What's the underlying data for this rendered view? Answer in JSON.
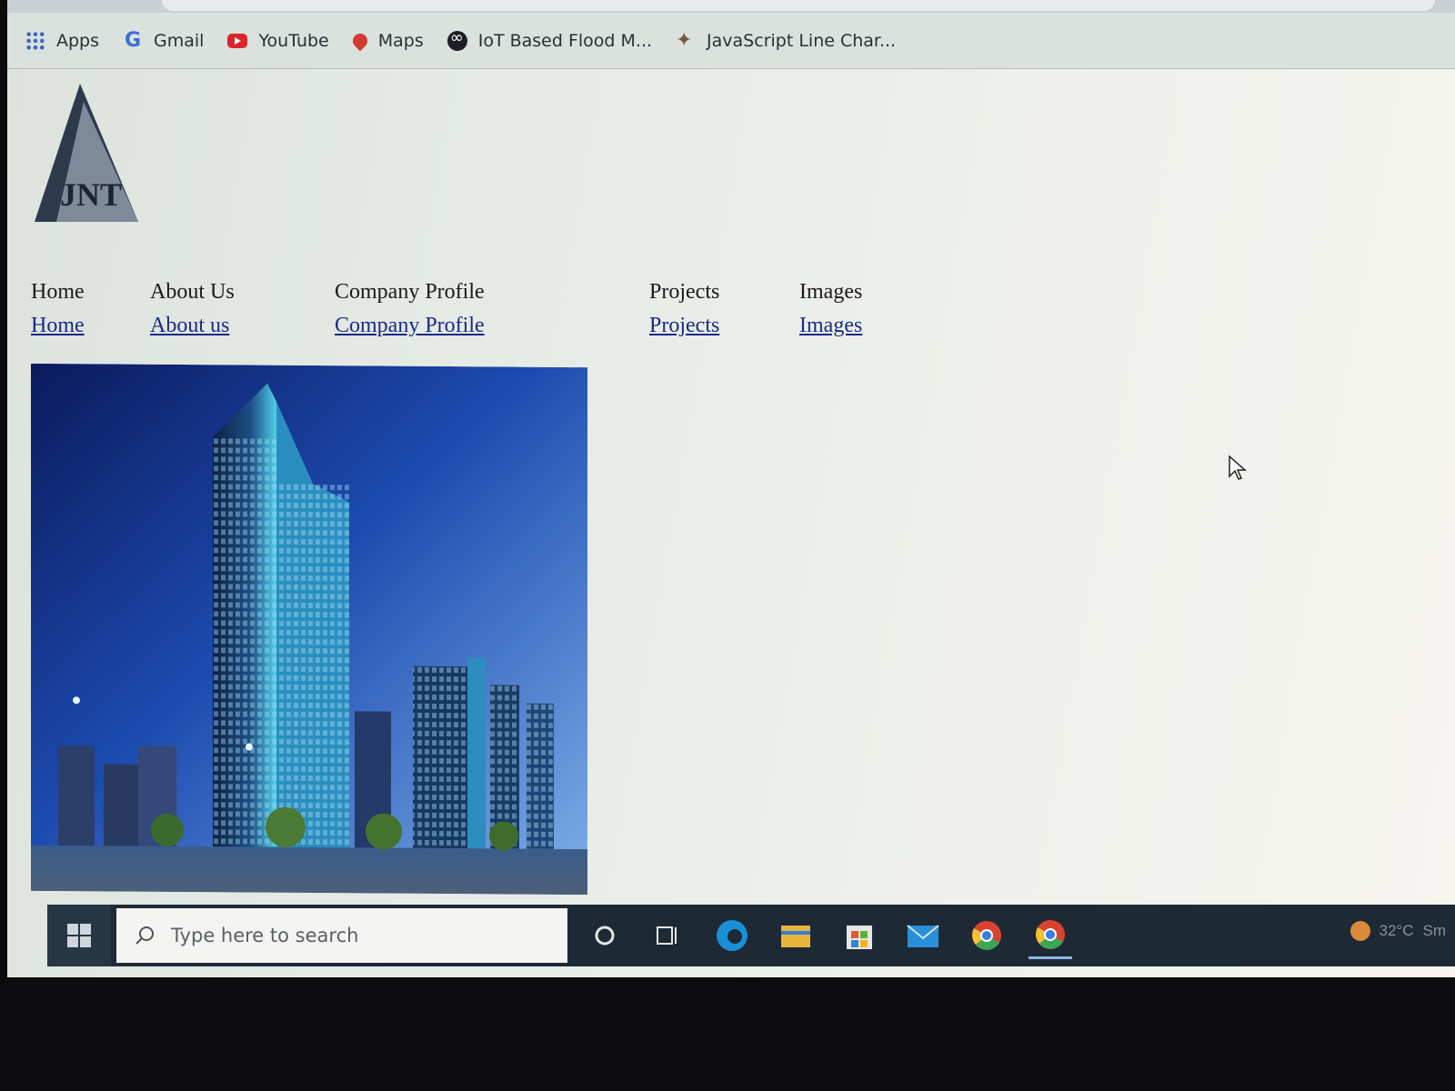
{
  "bookmarks": [
    {
      "label": "Apps",
      "icon": "apps-grid-icon"
    },
    {
      "label": "Gmail",
      "icon": "google-icon"
    },
    {
      "label": "YouTube",
      "icon": "youtube-icon"
    },
    {
      "label": "Maps",
      "icon": "maps-pin-icon"
    },
    {
      "label": "IoT Based Flood M...",
      "icon": "iot-icon"
    },
    {
      "label": "JavaScript Line Char...",
      "icon": "javascript-icon"
    }
  ],
  "logo": {
    "text": "JNT"
  },
  "nav": [
    {
      "title": "Home",
      "link": "Home"
    },
    {
      "title": "About Us",
      "link": "About us"
    },
    {
      "title": "Company Profile",
      "link": "Company Profile"
    },
    {
      "title": "Projects",
      "link": "Projects"
    },
    {
      "title": "Images",
      "link": "Images"
    }
  ],
  "taskbar": {
    "search_placeholder": "Type here to search",
    "temperature": "32°C",
    "weather": "Sm"
  },
  "colors": {
    "link": "#1a2a8a",
    "taskbar": "#1d2a36"
  }
}
